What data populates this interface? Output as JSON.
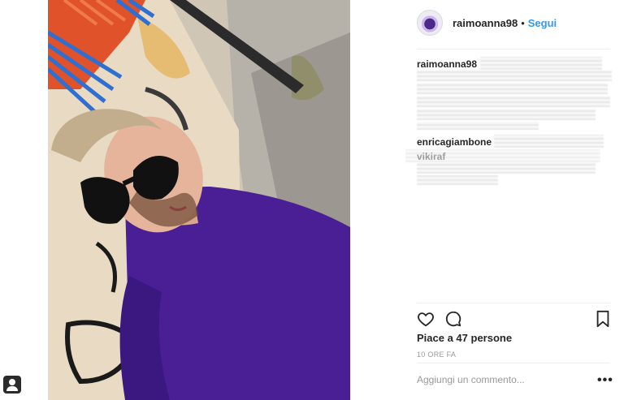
{
  "post": {
    "username": "raimoanna98",
    "separator": "•",
    "follow_label": "Segui"
  },
  "comments": [
    {
      "user": "raimoanna98"
    },
    {
      "user": "enricagiambone"
    },
    {
      "user": "vikiraf"
    }
  ],
  "engagement": {
    "likes_text": "Piace a 47 persone",
    "time_text": "10 ORE FA"
  },
  "comment_box": {
    "placeholder": "Aggiungi un commento...",
    "more_label": "•••"
  },
  "icons": {
    "like": "heart-icon",
    "comment": "comment-icon",
    "save": "bookmark-icon",
    "corner": "person-badge-icon"
  },
  "colors": {
    "link": "#3897f0",
    "text": "#262626",
    "muted": "#999999",
    "shirt": "#4a1f96"
  }
}
